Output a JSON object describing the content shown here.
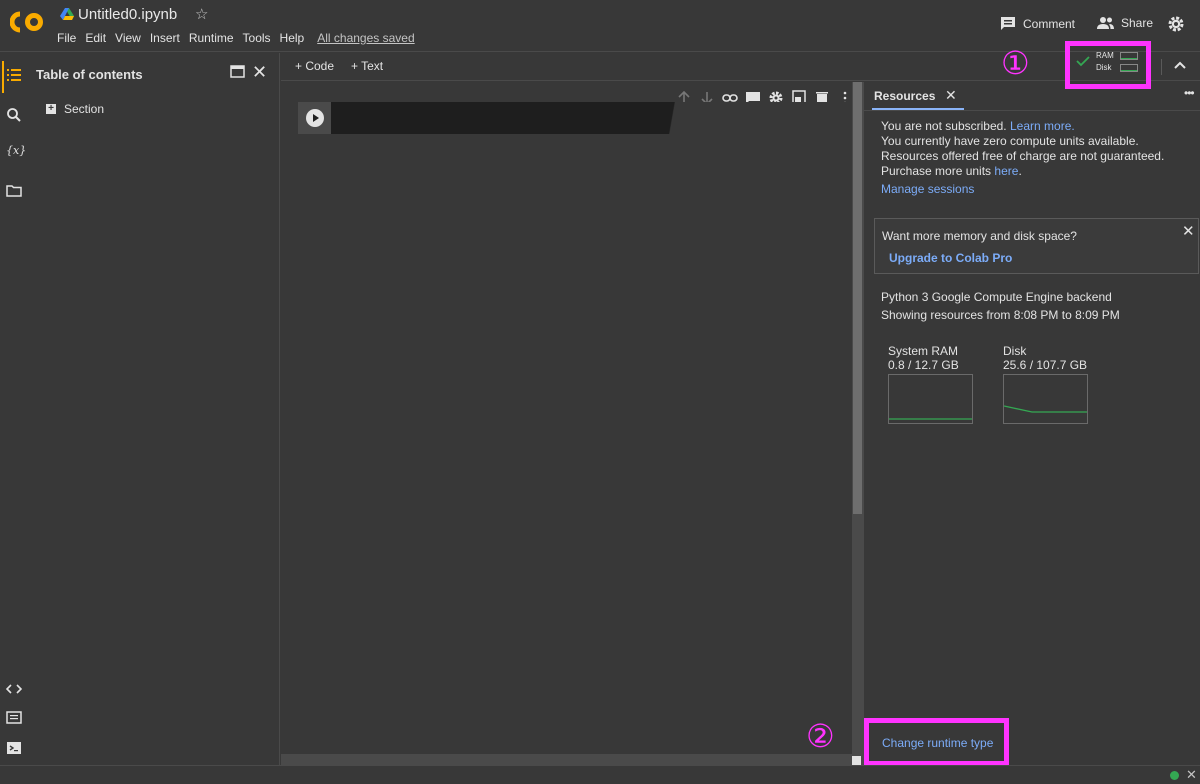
{
  "header": {
    "title": "Untitled0.ipynb",
    "menu": [
      "File",
      "Edit",
      "View",
      "Insert",
      "Runtime",
      "Tools",
      "Help"
    ],
    "saved_status": "All changes saved",
    "comment_label": "Comment",
    "share_label": "Share"
  },
  "toc": {
    "title": "Table of contents",
    "section_label": "Section"
  },
  "toolbar": {
    "add_code": "+ Code",
    "add_text": "+ Text",
    "ram_label": "RAM",
    "disk_label": "Disk",
    "annotation_1": "①"
  },
  "resources": {
    "tab_label": "Resources",
    "not_subscribed": "You are not subscribed.",
    "learn_more": "Learn more.",
    "compute_units_text": "You currently have zero compute units available. Resources offered free of charge are not guaranteed. Purchase more units",
    "here_link": "here",
    "manage_sessions": "Manage sessions",
    "upgrade_question": "Want more memory and disk space?",
    "upgrade_link": "Upgrade to Colab Pro",
    "backend_line": "Python 3 Google Compute Engine backend",
    "showing_line": "Showing resources from 8:08 PM to 8:09 PM",
    "system_ram": {
      "label": "System RAM",
      "value": "0.8 / 12.7 GB",
      "fraction": 0.063
    },
    "disk": {
      "label": "Disk",
      "value": "25.6 / 107.7 GB",
      "fraction": 0.238
    },
    "change_runtime": "Change runtime type",
    "annotation_2": "②"
  },
  "colors": {
    "accent": "#f9ab00",
    "link": "#7cacf8",
    "highlight": "#ff33ff",
    "ok": "#34a853"
  },
  "icons": [
    "colab-logo-icon",
    "drive-icon",
    "star-icon",
    "comment-icon",
    "share-icon",
    "gear-icon",
    "toc-icon",
    "search-icon",
    "variables-icon",
    "folder-icon",
    "code-snippets-icon",
    "command-palette-icon",
    "terminal-icon",
    "new-window-icon",
    "close-icon",
    "check-icon",
    "chevron-up-icon",
    "run-icon",
    "arrow-up-icon",
    "arrow-down-icon",
    "link-icon",
    "comment-cell-icon",
    "settings-icon",
    "mirror-icon",
    "delete-icon",
    "more-icon"
  ]
}
